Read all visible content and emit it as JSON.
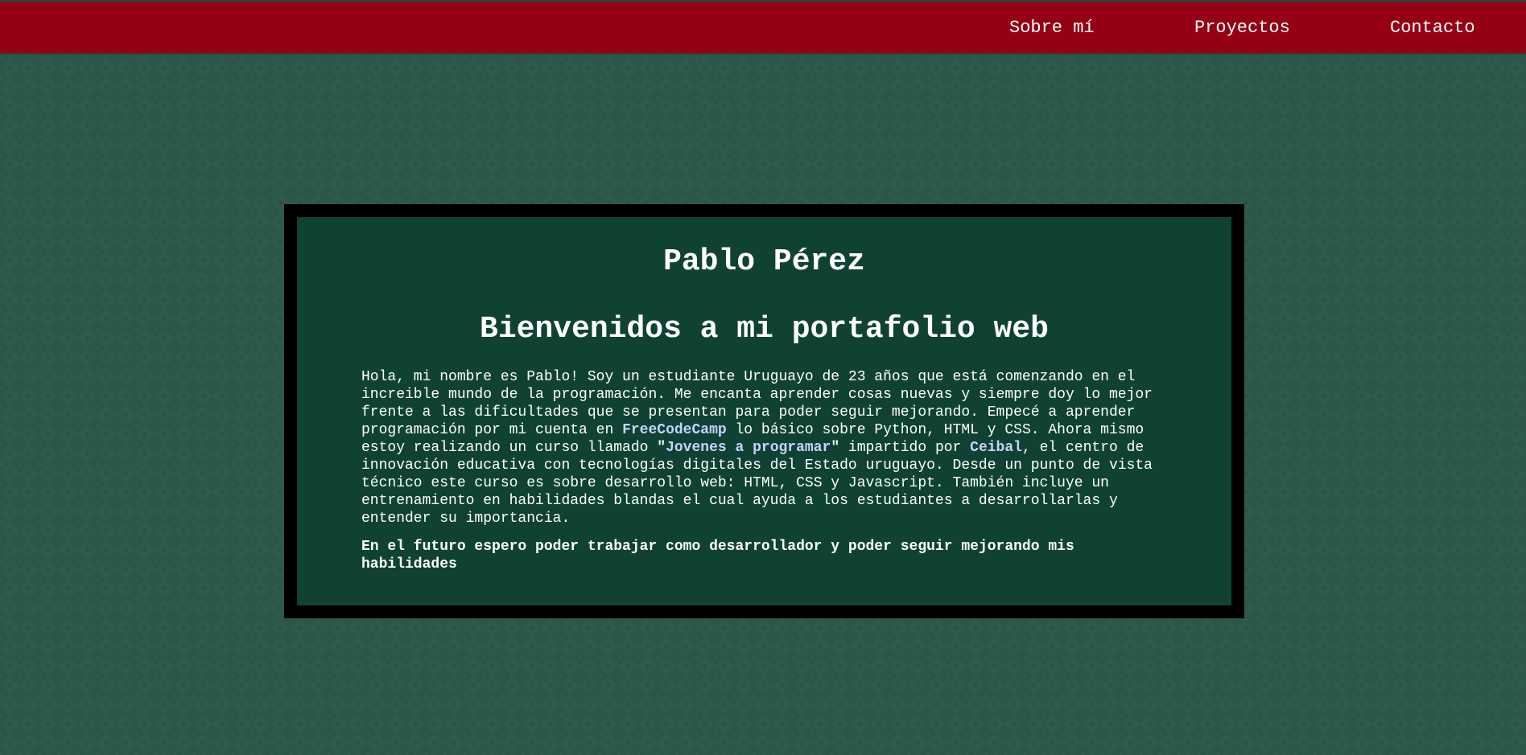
{
  "nav": {
    "items": [
      {
        "label": "Sobre mí"
      },
      {
        "label": "Proyectos"
      },
      {
        "label": "Contacto"
      }
    ]
  },
  "card": {
    "name": "Pablo Pérez",
    "heading": "Bienvenidos a mi portafolio web",
    "bio": {
      "part1": "Hola, mi nombre es Pablo! Soy un estudiante Uruguayo de 23 años que está comenzando en el increible mundo de la programación. Me encanta aprender cosas nuevas y siempre doy lo mejor frente a las dificultades que se presentan para poder seguir mejorando. Empecé a aprender programación por mi cuenta en ",
      "link1": "FreeCodeCamp",
      "part2": " lo básico sobre Python, HTML y CSS. Ahora mismo estoy realizando un curso llamado ",
      "quote_open": "\"",
      "link2": "Jovenes a programar",
      "quote_close": "\"",
      "part3": " impartido por ",
      "link3": "Ceibal",
      "part4": ", el centro de innovación educativa con tecnologías digitales del Estado uruguayo. Desde un punto de vista técnico este curso es sobre desarrollo web: HTML, CSS y Javascript. También incluye un entrenamiento en habilidades blandas el cual ayuda a los estudiantes a desarrollarlas y entender su importancia."
    },
    "future": "En el futuro espero poder trabajar como desarrollador y poder seguir mejorando mis habilidades"
  },
  "colors": {
    "background": "#2e5a4c",
    "navbar": "#960014",
    "card": "#104233",
    "card_border": "#000000",
    "link": "#c5d3ff"
  }
}
